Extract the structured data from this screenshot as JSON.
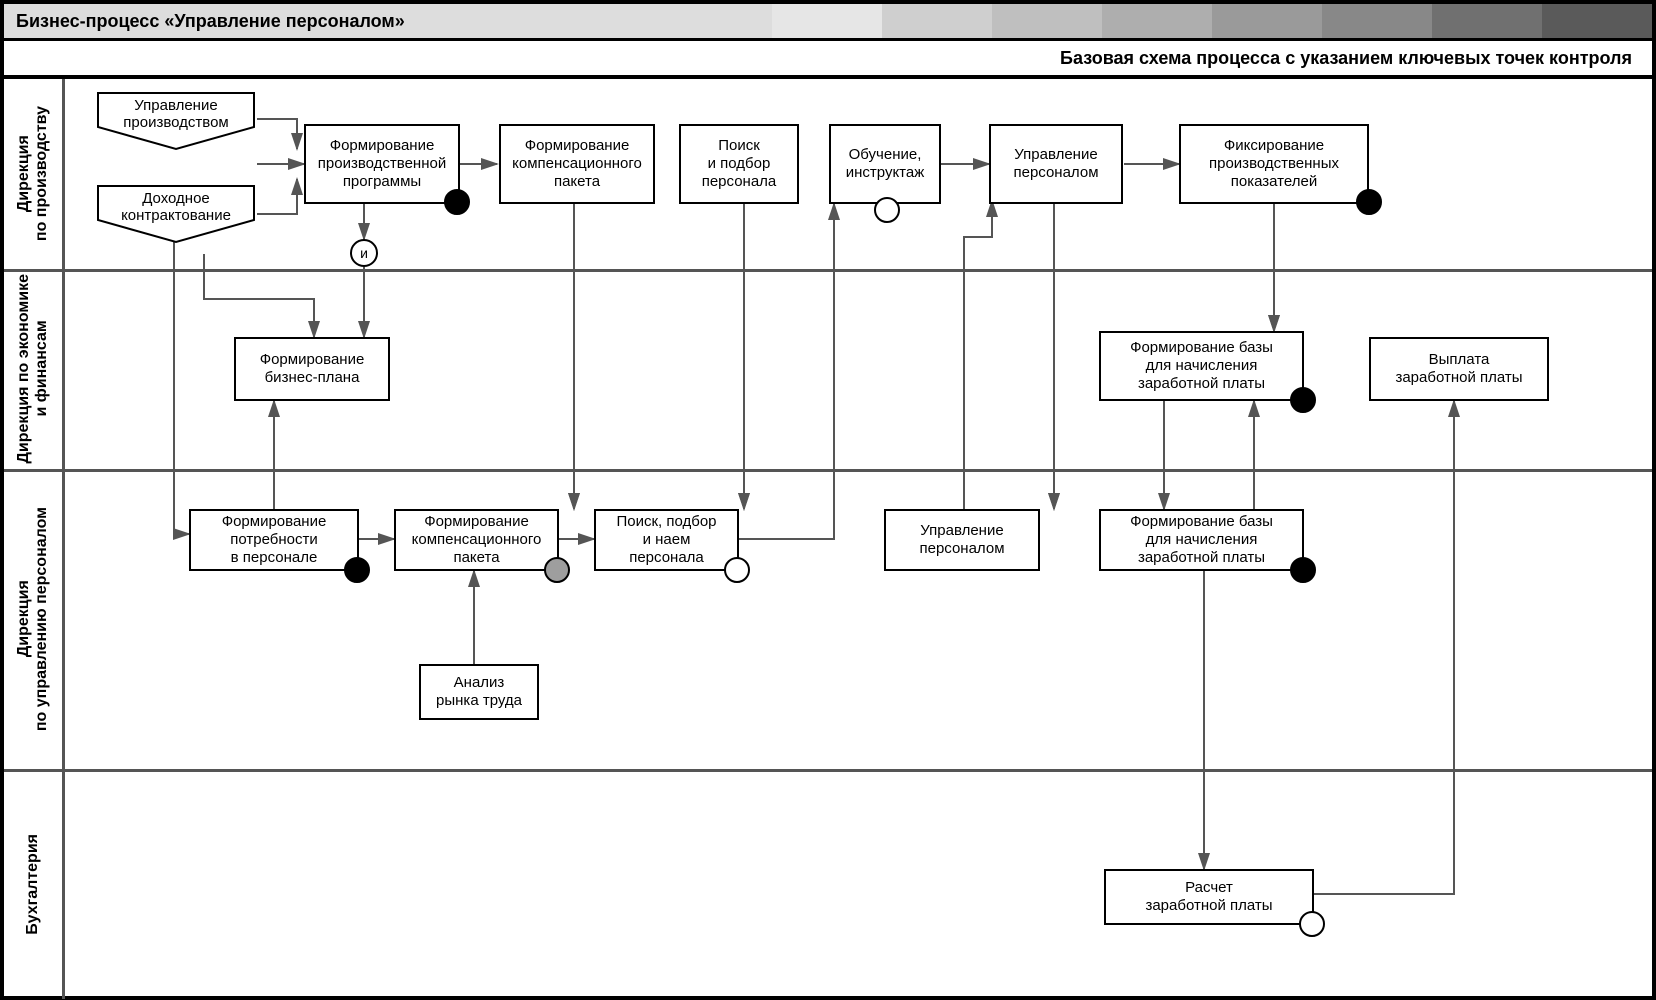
{
  "header": {
    "title": "Бизнес-процесс «Управление персоналом»",
    "bandColors": [
      "#e6e6e6",
      "#cfcfcf",
      "#bfbfbf",
      "#aeaeae",
      "#9a9a9a",
      "#888888",
      "#707070",
      "#5a5a5a"
    ]
  },
  "subheader": "Базовая схема процесса с указанием ключевых точек контроля",
  "lanes": [
    {
      "id": "l1",
      "label": "Дирекция\nпо производству"
    },
    {
      "id": "l2",
      "label": "Дирекция по экономике\nи финансам"
    },
    {
      "id": "l3",
      "label": "Дирекция\nпо управлению персоналом"
    },
    {
      "id": "l4",
      "label": "Бухгалтерия"
    }
  ],
  "inputs": {
    "prod_mgmt": "Управление\nпроизводством",
    "income_contract": "Доходное\nконтрактование"
  },
  "gate_and": "и",
  "boxes": {
    "prod_prog": "Формирование\nпроизводственной\nпрограммы",
    "comp_pack_top": "Формирование\nкомпенсационного\nпакета",
    "search_top": "Поиск\nи подбор\nперсонала",
    "training": "Обучение,\nинструктаж",
    "hr_mgmt_top": "Управление\nперсоналом",
    "fix_indicators": "Фиксирование\nпроизводственных\nпоказателей",
    "biz_plan": "Формирование\nбизнес-плана",
    "payroll_base_fin": "Формирование базы\nдля начисления\nзаработной платы",
    "pay_out": "Выплата\nзаработной платы",
    "hr_need": "Формирование\nпотребности\nв персонале",
    "comp_pack_hr": "Формирование\nкомпенсационного\nпакета",
    "search_hr": "Поиск, подбор\nи наем\nперсонала",
    "hr_mgmt_hr": "Управление\nперсоналом",
    "payroll_base_hr": "Формирование базы\nдля начисления\nзаработной платы",
    "market": "Анализ\nрынка труда",
    "payroll_calc": "Расчет\nзаработной платы"
  }
}
